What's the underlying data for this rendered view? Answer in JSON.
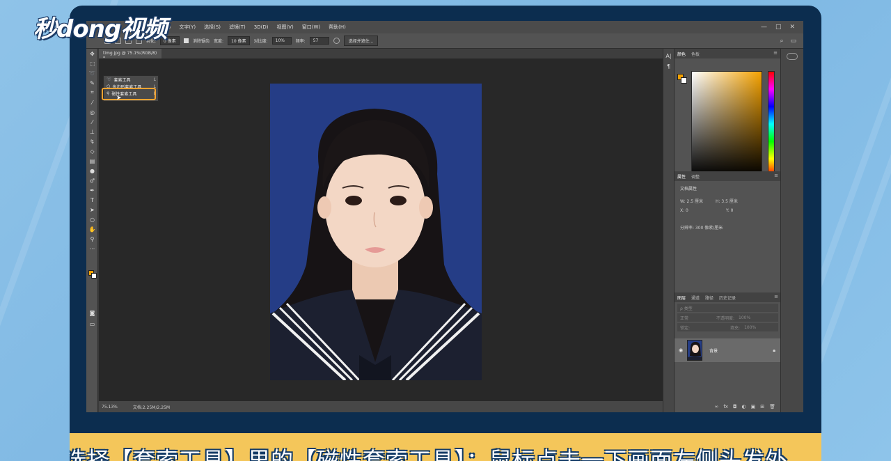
{
  "brand": {
    "logo_text": "秒dong视频"
  },
  "menubar": {
    "items": [
      "图层(L)",
      "文字(Y)",
      "选择(S)",
      "滤镜(T)",
      "3D(D)",
      "视图(V)",
      "窗口(W)",
      "帮助(H)"
    ],
    "win_controls": [
      "—",
      "□",
      "✕"
    ]
  },
  "options": {
    "feather_label": "羽化:",
    "feather_value": "0 像素",
    "antialias_label": "消除锯齿",
    "width_label": "宽度:",
    "width_value": "10 像素",
    "contrast_label": "对比度:",
    "contrast_value": "10%",
    "frequency_label": "频率:",
    "frequency_value": "57",
    "select_mask_button": "选择并遮住...",
    "right_icons": [
      "⌕",
      "▭"
    ]
  },
  "document": {
    "tab_title": "timg.jpg @ 75.1%(RGB/8) *",
    "zoom": "75.13%",
    "doc_info": "文档:2.25M/2.25M"
  },
  "lasso_flyout": {
    "items": [
      {
        "label": "套索工具",
        "key": "L"
      },
      {
        "label": "多边形套索工具",
        "key": "L"
      },
      {
        "label": "磁性套索工具",
        "key": "L"
      }
    ]
  },
  "color_panel": {
    "tabs": [
      "颜色",
      "色板"
    ],
    "fg_color": "#f5a200",
    "bg_color": "#ffffff"
  },
  "properties_panel": {
    "tabs": [
      "属性",
      "调整"
    ],
    "title": "文档属性",
    "w": "W:  2.5 厘米",
    "h": "H:  3.5 厘米",
    "x": "X:  0",
    "y": "Y:  0",
    "resolution": "分辨率: 300 像素/厘米"
  },
  "layers_panel": {
    "tabs": [
      "图层",
      "通道",
      "路径",
      "历史记录"
    ],
    "kind_label": "ρ 类型",
    "blend_mode": "正常",
    "opacity_label": "不透明度:",
    "opacity_value": "100%",
    "lock_label": "锁定:",
    "fill_label": "填充:",
    "fill_value": "100%",
    "layer_name": "背景"
  },
  "caption": {
    "text": "选择【套索工具】里的【磁性套索工具】：鼠标点击一下画面左侧头发外"
  }
}
